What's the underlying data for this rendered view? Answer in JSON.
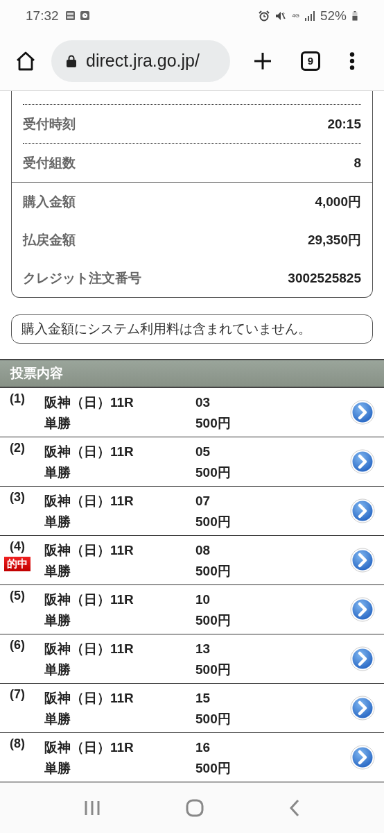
{
  "status_bar": {
    "time": "17:32",
    "network": "4G",
    "battery": "52%"
  },
  "browser": {
    "url": "direct.jra.go.jp/",
    "tab_count": "9"
  },
  "summary": {
    "sections": [
      {
        "dotted": true,
        "rows": [
          {
            "label": "受付時刻",
            "value": "20:15"
          },
          {
            "label": "受付組数",
            "value": "8"
          }
        ]
      },
      {
        "dotted": false,
        "rows": [
          {
            "label": "購入金額",
            "value": "4,000円"
          },
          {
            "label": "払戻金額",
            "value": "29,350円"
          },
          {
            "label": "クレジット注文番号",
            "value": "3002525825"
          }
        ]
      }
    ]
  },
  "notice": "購入金額にシステム利用料は含まれていません。",
  "bets": {
    "title": "投票内容",
    "rows": [
      {
        "number": "(1)",
        "race": "阪神（日）11R",
        "bet_type": "単勝",
        "horse": "03",
        "amount": "500円"
      },
      {
        "number": "(2)",
        "race": "阪神（日）11R",
        "bet_type": "単勝",
        "horse": "05",
        "amount": "500円"
      },
      {
        "number": "(3)",
        "race": "阪神（日）11R",
        "bet_type": "単勝",
        "horse": "07",
        "amount": "500円"
      },
      {
        "number": "(4)",
        "badge": "的中",
        "race": "阪神（日）11R",
        "bet_type": "単勝",
        "horse": "08",
        "amount": "500円"
      },
      {
        "number": "(5)",
        "race": "阪神（日）11R",
        "bet_type": "単勝",
        "horse": "10",
        "amount": "500円"
      },
      {
        "number": "(6)",
        "race": "阪神（日）11R",
        "bet_type": "単勝",
        "horse": "13",
        "amount": "500円"
      },
      {
        "number": "(7)",
        "race": "阪神（日）11R",
        "bet_type": "単勝",
        "horse": "15",
        "amount": "500円"
      },
      {
        "number": "(8)",
        "race": "阪神（日）11R",
        "bet_type": "単勝",
        "horse": "16",
        "amount": "500円"
      }
    ]
  }
}
